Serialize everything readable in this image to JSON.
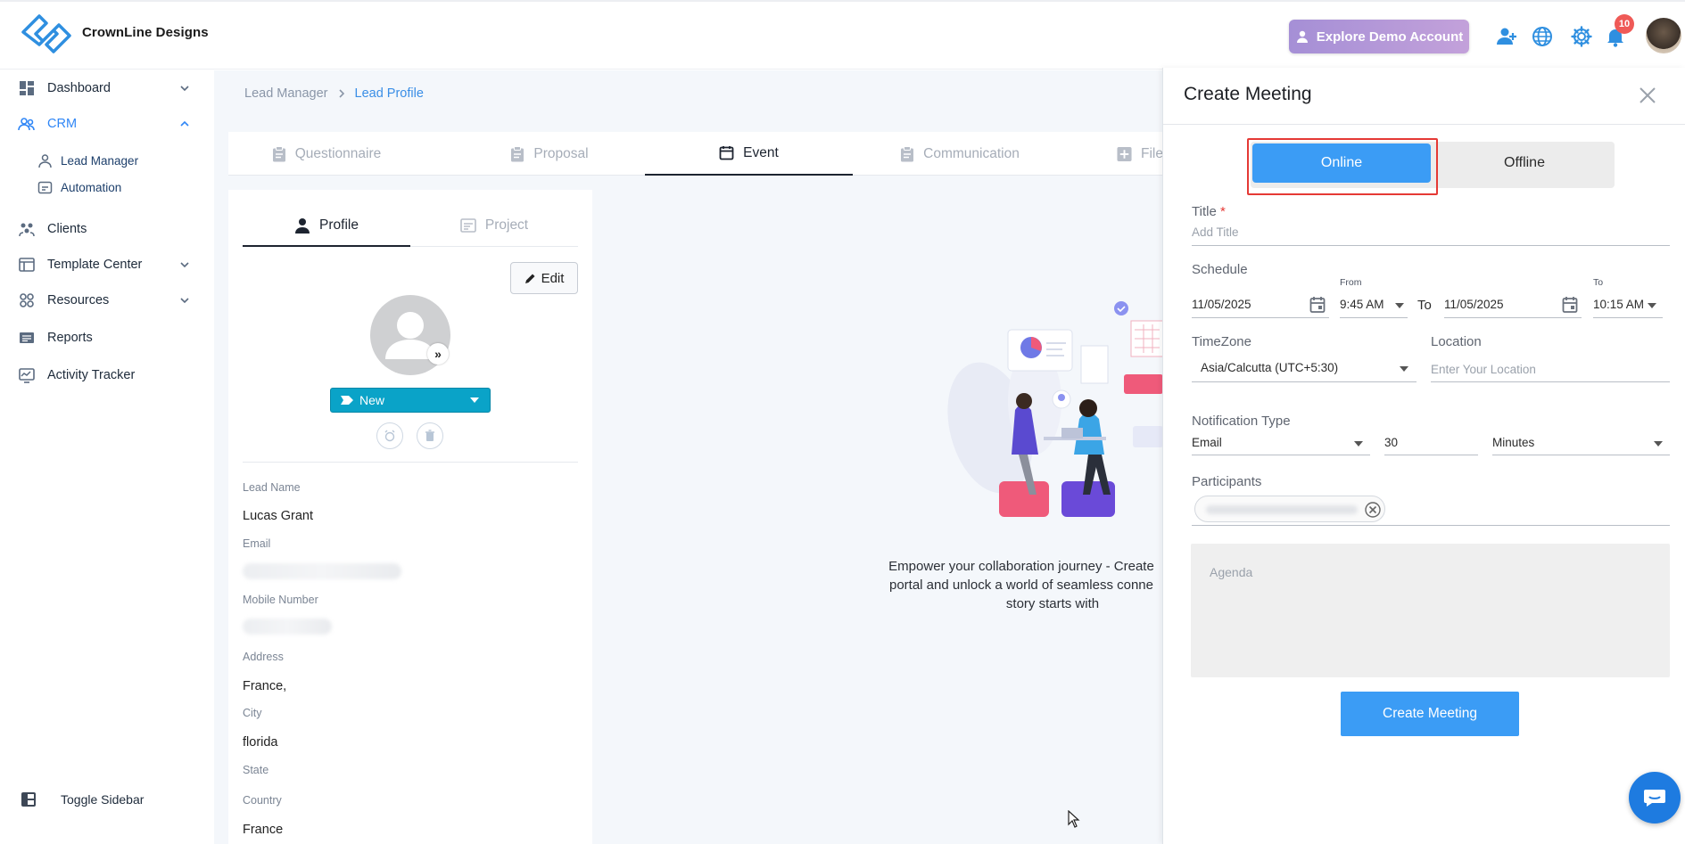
{
  "header": {
    "brand": "CrownLine Designs",
    "demo_button": "Explore Demo Account",
    "notification_count": "10"
  },
  "sidebar": {
    "items": [
      {
        "label": "Dashboard",
        "icon": "dashboard-icon"
      },
      {
        "label": "CRM",
        "icon": "crm-icon"
      },
      {
        "label": "Lead Manager",
        "icon": "lead-manager-icon"
      },
      {
        "label": "Automation",
        "icon": "automation-icon"
      },
      {
        "label": "Clients",
        "icon": "clients-icon"
      },
      {
        "label": "Template Center",
        "icon": "template-icon"
      },
      {
        "label": "Resources",
        "icon": "resources-icon"
      },
      {
        "label": "Reports",
        "icon": "reports-icon"
      },
      {
        "label": "Activity Tracker",
        "icon": "activity-icon"
      }
    ],
    "toggle": "Toggle Sidebar"
  },
  "breadcrumb": {
    "parent": "Lead Manager",
    "current": "Lead Profile"
  },
  "tabs": [
    "Questionnaire",
    "Proposal",
    "Event",
    "Communication",
    "File"
  ],
  "active_tab": "Event",
  "profile": {
    "tabs": [
      "Profile",
      "Project"
    ],
    "edit": "Edit",
    "status": "New",
    "fields": {
      "lead_name_label": "Lead Name",
      "lead_name": "Lucas Grant",
      "email_label": "Email",
      "mobile_label": "Mobile Number",
      "address_label": "Address",
      "address": "France,",
      "city_label": "City",
      "city": "florida",
      "state_label": "State",
      "country_label": "Country",
      "country": "France"
    }
  },
  "empty_state": {
    "line1": "Empower your collaboration journey - Create",
    "line2": "portal and unlock a world of seamless conne",
    "line3": "story starts with"
  },
  "meeting": {
    "title": "Create Meeting",
    "mode_online": "Online",
    "mode_offline": "Offline",
    "title_label": "Title",
    "required_mark": "*",
    "title_placeholder": "Add Title",
    "schedule_label": "Schedule",
    "from_label": "From",
    "to_label": "To",
    "to_word": "To",
    "start_date": "11/05/2025",
    "start_time": "9:45 AM",
    "end_date": "11/05/2025",
    "end_time": "10:15 AM",
    "timezone_label": "TimeZone",
    "timezone": "Asia/Calcutta (UTC+5:30)",
    "location_label": "Location",
    "location_placeholder": "Enter Your Location",
    "notification_label": "Notification Type",
    "notification_type": "Email",
    "notification_value": "30",
    "notification_unit": "Minutes",
    "participants_label": "Participants",
    "agenda_placeholder": "Agenda",
    "submit": "Create Meeting"
  },
  "colors": {
    "primary": "#3b9cf5",
    "status": "#0aa3c8",
    "highlight": "#e53935",
    "badge": "#ef5a57"
  }
}
